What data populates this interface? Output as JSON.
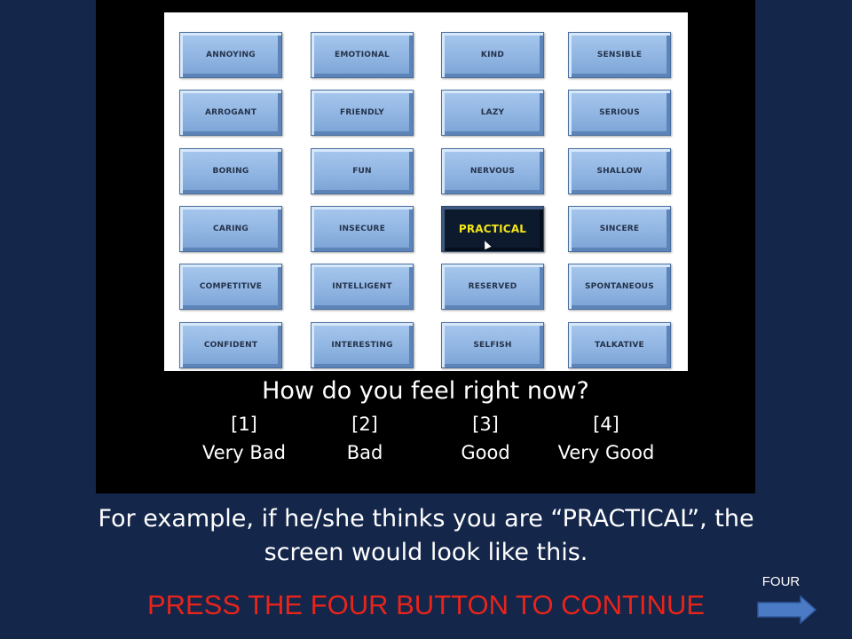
{
  "grid": {
    "rows": [
      [
        "ANNOYING",
        "EMOTIONAL",
        "KIND",
        "SENSIBLE"
      ],
      [
        "ARROGANT",
        "FRIENDLY",
        "LAZY",
        "SERIOUS"
      ],
      [
        "BORING",
        "FUN",
        "NERVOUS",
        "SHALLOW"
      ],
      [
        "CARING",
        "INSECURE",
        "PRACTICAL",
        "SINCERE"
      ],
      [
        "COMPETITIVE",
        "INTELLIGENT",
        "RESERVED",
        "SPONTANEOUS"
      ],
      [
        "CONFIDENT",
        "INTERESTING",
        "SELFISH",
        "TALKATIVE"
      ]
    ],
    "selected": "PRACTICAL"
  },
  "question": "How do you feel right now?",
  "options": [
    {
      "key": "[1]",
      "label": "Very Bad"
    },
    {
      "key": "[2]",
      "label": "Bad"
    },
    {
      "key": "[3]",
      "label": "Good"
    },
    {
      "key": "[4]",
      "label": "Very Good"
    }
  ],
  "instruction": {
    "line1": "For example, if he/she thinks you are “PRACTICAL”, the",
    "line2": "screen would look like this."
  },
  "prompt": "PRESS THE FOUR BUTTON TO CONTINUE",
  "next": {
    "label": "FOUR",
    "icon": "right-arrow-icon"
  },
  "colors": {
    "background": "#14264a",
    "screen": "#000000",
    "tile": "#90b5e2",
    "selected_tile": "#0d1a2d",
    "selected_text": "#f2e51a",
    "prompt_text": "#e8241b",
    "arrow": "#4a7bc4"
  }
}
